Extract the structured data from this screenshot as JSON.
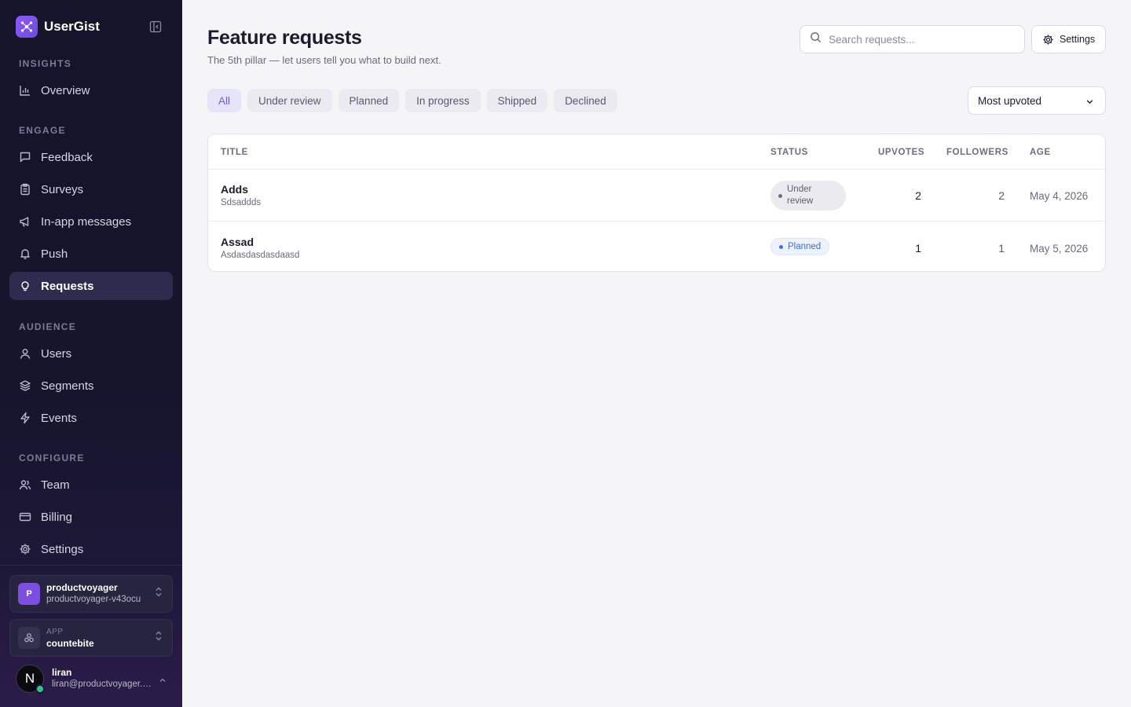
{
  "brand": {
    "name": "UserGist"
  },
  "sidebar": {
    "sections": {
      "insights": "INSIGHTS",
      "engage": "ENGAGE",
      "audience": "AUDIENCE",
      "configure": "CONFIGURE"
    },
    "items": {
      "overview": "Overview",
      "feedback": "Feedback",
      "surveys": "Surveys",
      "inapp": "In-app messages",
      "push": "Push",
      "requests": "Requests",
      "users": "Users",
      "segments": "Segments",
      "events": "Events",
      "team": "Team",
      "billing": "Billing",
      "settings": "Settings"
    },
    "active_item": "Requests",
    "org": {
      "initial": "P",
      "name": "productvoyager",
      "slug": "productvoyager-v43ocu"
    },
    "app": {
      "label": "APP",
      "name": "countebite"
    },
    "user": {
      "initial": "N",
      "name": "liran",
      "email": "liran@productvoyager.co..."
    }
  },
  "page": {
    "title": "Feature requests",
    "subtitle": "The 5th pillar — let users tell you what to build next."
  },
  "search": {
    "placeholder": "Search requests..."
  },
  "settings_button": {
    "label": "Settings"
  },
  "filters": {
    "all": "All",
    "under_review": "Under review",
    "planned": "Planned",
    "in_progress": "In progress",
    "shipped": "Shipped",
    "declined": "Declined",
    "active": "All"
  },
  "sort": {
    "selected": "Most upvoted"
  },
  "table": {
    "headers": {
      "title": "TITLE",
      "status": "STATUS",
      "upvotes": "UPVOTES",
      "followers": "FOLLOWERS",
      "age": "AGE"
    },
    "rows": [
      {
        "title": "Adds",
        "description": "Sdsaddds",
        "status_line1": "Under",
        "status_line2": "review",
        "upvotes": "2",
        "followers": "2",
        "age": "May 4, 2026"
      },
      {
        "title": "Assad",
        "description": "Asdasdasdasdaasd",
        "status": "Planned",
        "upvotes": "1",
        "followers": "1",
        "age": "May 5, 2026"
      }
    ]
  },
  "colors": {
    "accent": "#6b5ce7",
    "sidebar_bg": "#15142a",
    "planned": "#3b6fe0",
    "online": "#34c38f"
  }
}
